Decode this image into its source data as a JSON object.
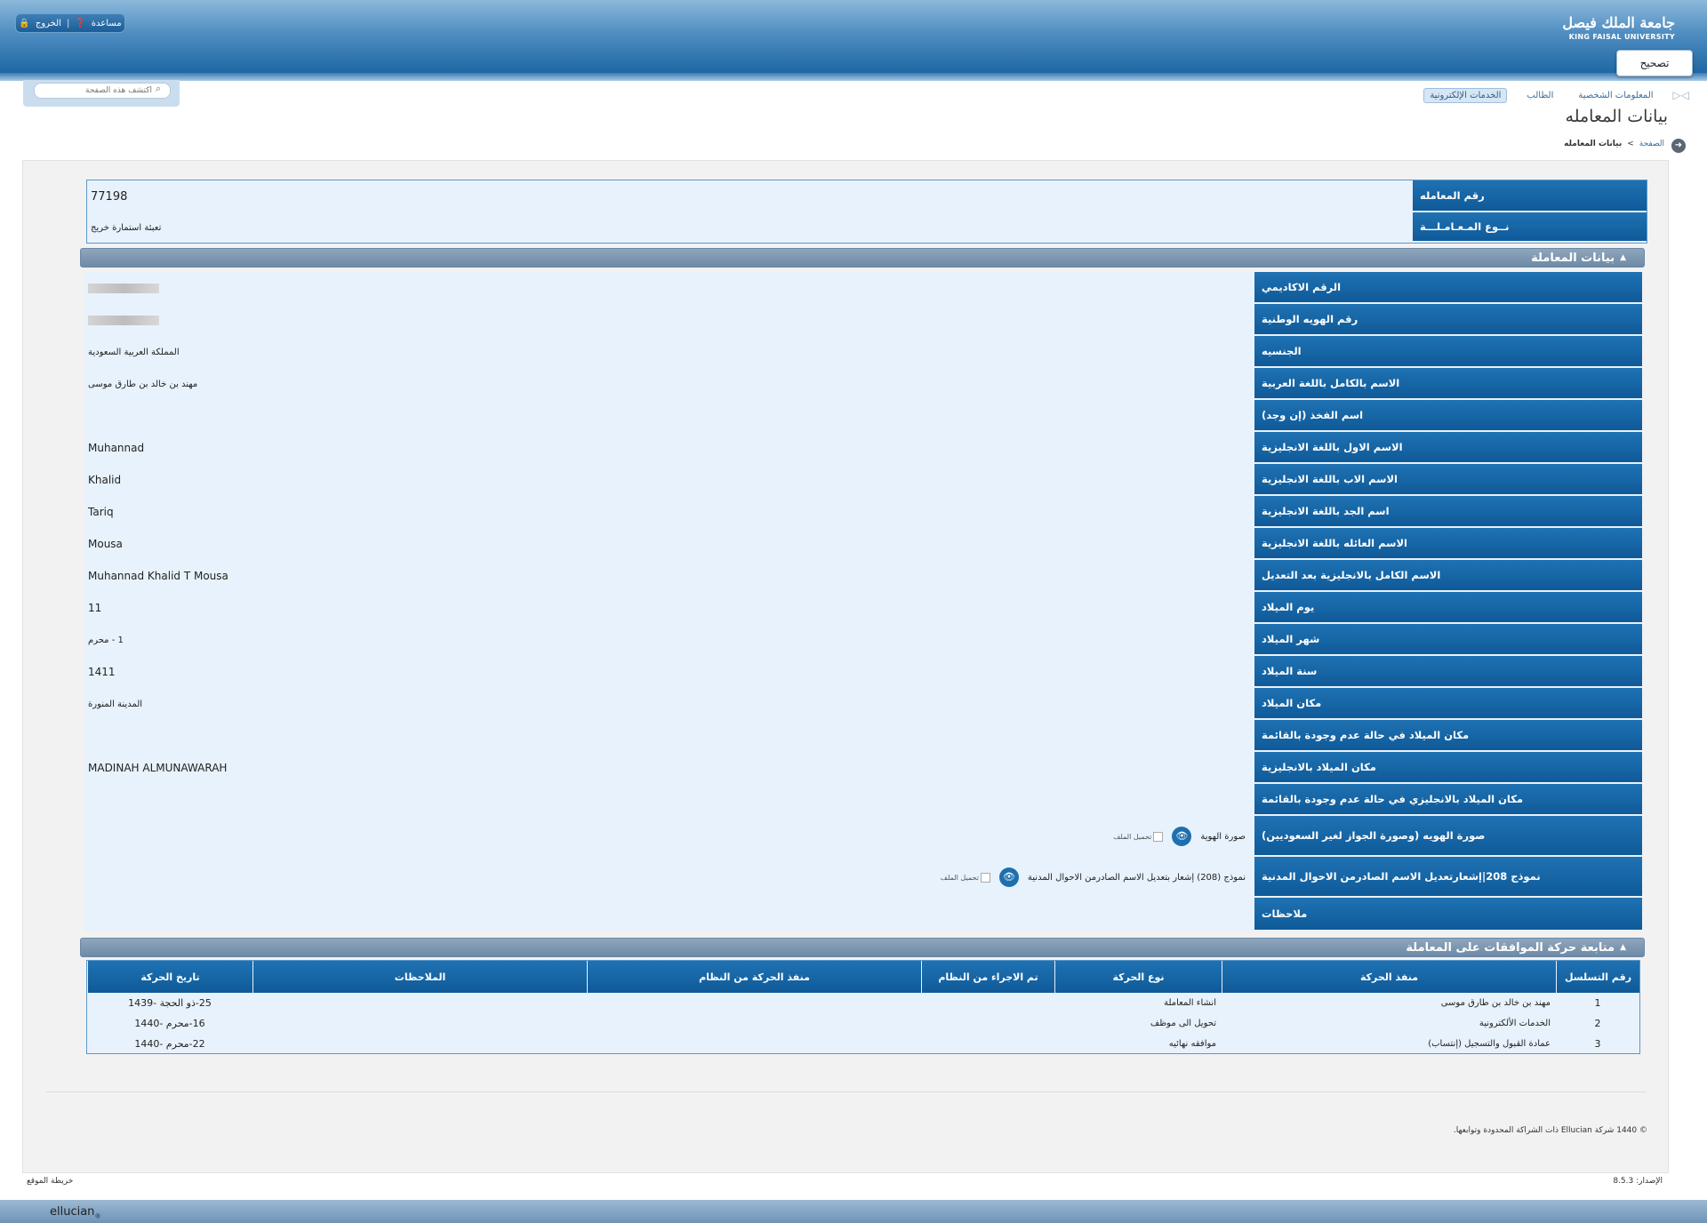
{
  "header": {
    "logo_ar": "جامعة الملك فيصل",
    "logo_en": "KING FAISAL UNIVERSITY",
    "logout_label": "الخروج",
    "help_label": "مساعدة",
    "fix_button": "تصحيح"
  },
  "search": {
    "placeholder": "اكتشف هذه الصفحة"
  },
  "nav": {
    "tabs": [
      "المعلومات الشخصية",
      "الطالب",
      "الخدمات الإلكترونية"
    ],
    "active_tab": "الخدمات الإلكترونية"
  },
  "page": {
    "title": "بيانات المعامله",
    "breadcrumb_home": "الصفحة",
    "breadcrumb_sep": ">",
    "breadcrumb_current": "بيانات المعامله"
  },
  "transaction": {
    "number_label": "رقم المعامله",
    "number_value": "77198",
    "type_label": "نــوع المـعـامـلـــة",
    "type_value": "تعبئة استمارة خريج"
  },
  "section1": {
    "title": "بيانات المعاملة"
  },
  "details": [
    {
      "label": "الرقم الاكاديمي",
      "value": ""
    },
    {
      "label": "رقم الهويه الوطنية",
      "value": ""
    },
    {
      "label": "الجنسيه",
      "value": "المملكة العربية السعودية"
    },
    {
      "label": "الاسم بالكامل باللغة العربية",
      "value": "مهند بن خالد بن طارق موسى"
    },
    {
      "label": "اسم الفخذ (إن وجد)",
      "value": ""
    },
    {
      "label": "الاسم الاول باللغة الانجليزية",
      "value": "Muhannad"
    },
    {
      "label": "الاسم الاب باللغة الانجليزية",
      "value": "Khalid"
    },
    {
      "label": "اسم الجد باللغة الانجليزية",
      "value": "Tariq"
    },
    {
      "label": "الاسم العائله باللغة الانجليزية",
      "value": "Mousa"
    },
    {
      "label": "الاسم الكامل بالانجليزية بعد التعديل",
      "value": "Muhannad Khalid T Mousa"
    },
    {
      "label": "يوم الميلاد",
      "value": "11"
    },
    {
      "label": "شهر الميلاد",
      "value": "1 - محرم"
    },
    {
      "label": "سنة الميلاد",
      "value": "1411"
    },
    {
      "label": "مكان الميلاد",
      "value": "المدينة المنورة"
    },
    {
      "label": "مكان الميلاد في حالة عدم وجودة بالقائمة",
      "value": ""
    },
    {
      "label": "مكان الميلاد بالانجليزية",
      "value": "MADINAH ALMUNAWARAH"
    },
    {
      "label": "مكان الميلاد بالانجليزي في حالة عدم وجودة بالقائمة",
      "value": ""
    }
  ],
  "files": [
    {
      "label": "صورة الهويه (وصورة الجواز لغير السعوديين)",
      "file_title": "صورة الهوية",
      "alt": "تحميل الملف"
    },
    {
      "label": "نموذج 208|إشعارتعديل الاسم الصادرمن الاحوال المدنية",
      "file_title": "نموذج (208) إشعار بتعديل الاسم الصادرمن الاحوال المدنية",
      "alt": "تحميل الملف"
    }
  ],
  "notes_label": "ملاحظات",
  "section2": {
    "title": "متابعة حركة الموافقات على المعاملة"
  },
  "movement": {
    "headers": [
      "رقم التسلسل",
      "منفذ الحركة",
      "نوع الحركة",
      "تم الاجراء من النظام",
      "منفذ الحركة من النظام",
      "الملاحظات",
      "تاريخ الحركة"
    ],
    "rows": [
      [
        "1",
        "مهند بن خالد بن طارق موسى",
        "انشاء المعاملة",
        "",
        "",
        "",
        "25-ذو الحجة -1439"
      ],
      [
        "2",
        "الخدمات الألكترونية",
        "تحويل الى موظف",
        "",
        "",
        "",
        "16-محرم -1440"
      ],
      [
        "3",
        "عمادة القبول والتسجيل (إنتساب)",
        "موافقه نهائيه",
        "",
        "",
        "",
        "22-محرم -1440"
      ]
    ]
  },
  "footer": {
    "copyright": "© 1440 شركة Ellucian ذات الشراكة المحدودة وتوابعها.",
    "version": "الإصدار: 8.5.3",
    "sitemap": "خريطة الموقع",
    "brand": "ellucian"
  }
}
